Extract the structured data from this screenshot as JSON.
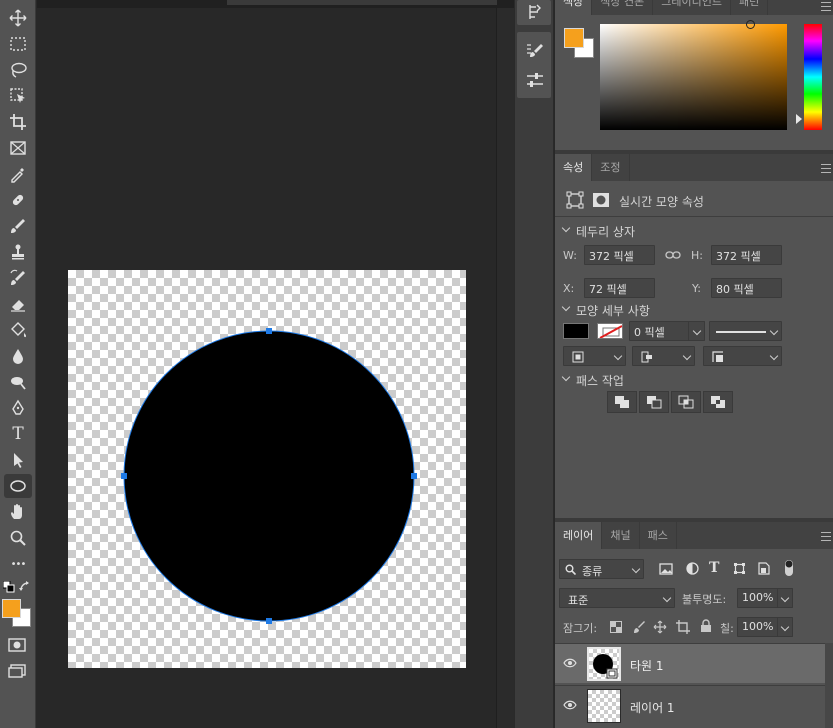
{
  "toolbar": {
    "tools": [
      {
        "name": "move-tool-icon"
      },
      {
        "name": "marquee-tool-icon"
      },
      {
        "name": "lasso-tool-icon"
      },
      {
        "name": "object-selection-tool-icon"
      },
      {
        "name": "crop-tool-icon"
      },
      {
        "name": "frame-tool-icon"
      },
      {
        "name": "eyedropper-tool-icon"
      },
      {
        "name": "healing-brush-tool-icon"
      },
      {
        "name": "brush-tool-icon"
      },
      {
        "name": "clone-stamp-tool-icon"
      },
      {
        "name": "history-brush-tool-icon"
      },
      {
        "name": "eraser-tool-icon"
      },
      {
        "name": "paint-bucket-tool-icon"
      },
      {
        "name": "blur-tool-icon"
      },
      {
        "name": "dodge-tool-icon"
      },
      {
        "name": "pen-tool-icon"
      },
      {
        "name": "type-tool-icon",
        "glyph": "T"
      },
      {
        "name": "path-selection-tool-icon"
      },
      {
        "name": "ellipse-tool-icon",
        "active": true
      },
      {
        "name": "hand-tool-icon"
      },
      {
        "name": "zoom-tool-icon"
      },
      {
        "name": "more-tools-icon",
        "glyph": "•••"
      }
    ],
    "foreground_color": "#f5a01d",
    "background_color": "#ffffff"
  },
  "color_panel": {
    "tabs": [
      "색상",
      "색상 견본",
      "그레이디언트",
      "패턴"
    ],
    "foreground_color": "#f5a01d",
    "background_color": "#ffffff",
    "hue_color": "#ff9a00"
  },
  "properties_panel": {
    "tabs": [
      "속성",
      "조정"
    ],
    "header_label": "실시간 모양 속성",
    "bounding_box": {
      "title": "테두리 상자",
      "w_label": "W:",
      "w_value": "372 픽셀",
      "h_label": "H:",
      "h_value": "372 픽셀",
      "x_label": "X:",
      "x_value": "72 픽셀",
      "y_label": "Y:",
      "y_value": "80 픽셀"
    },
    "shape_details": {
      "title": "모양 세부 사항",
      "fill_color": "#000000",
      "stroke_width": "0 픽셀"
    },
    "path_ops": {
      "title": "패스 작업"
    }
  },
  "layers_panel": {
    "tabs": [
      "레이어",
      "채널",
      "패스"
    ],
    "filter_label": "종류",
    "blend_mode": "표준",
    "opacity_label": "불투명도:",
    "opacity_value": "100%",
    "lock_label": "잠그기:",
    "fill_label": "칠:",
    "fill_value": "100%",
    "layers": [
      {
        "name": "타원 1",
        "selected": true
      },
      {
        "name": "레이어 1",
        "selected": false
      }
    ]
  },
  "document": {
    "shape_fill": "#000000",
    "selection_color": "#1e7ae6"
  }
}
